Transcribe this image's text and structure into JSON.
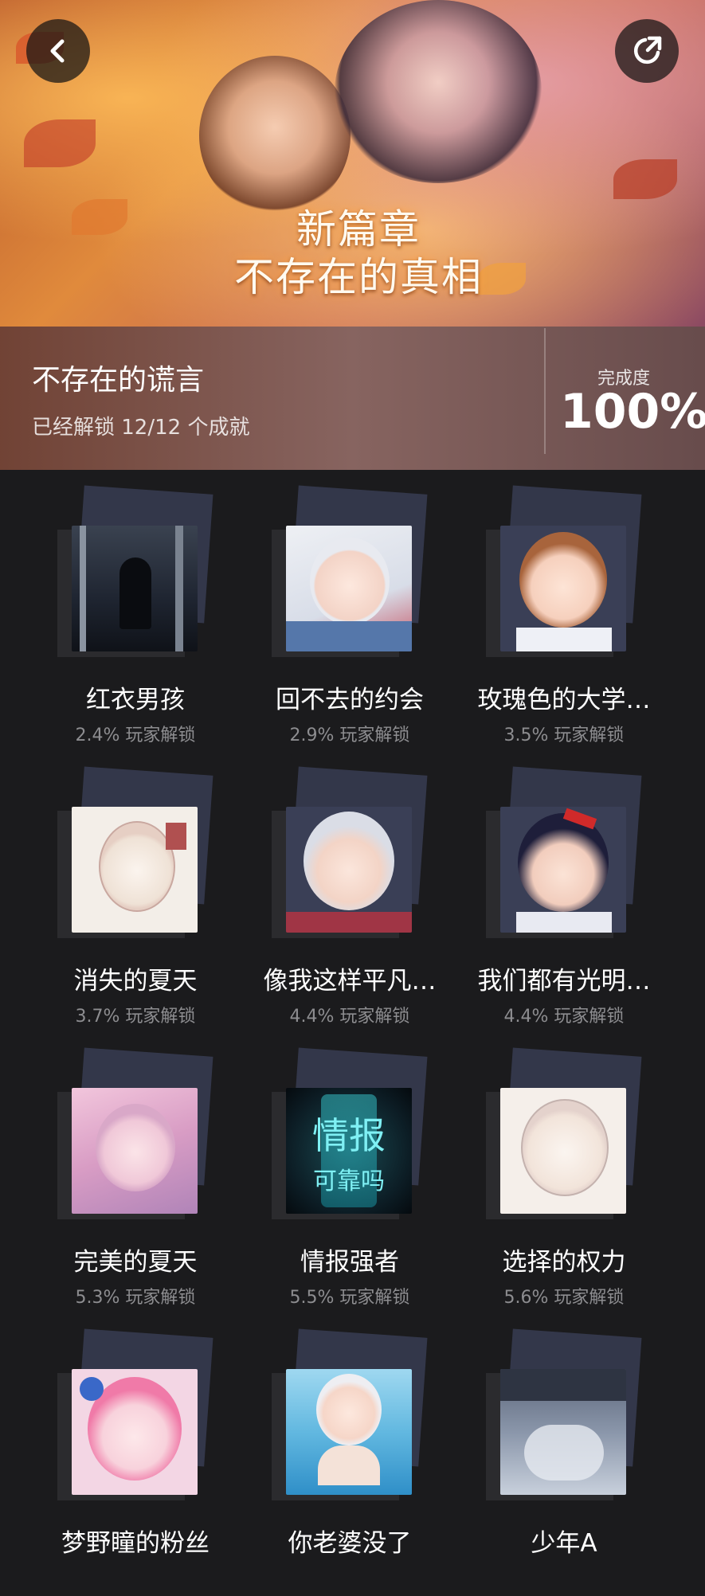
{
  "header": {
    "banner_title_line1": "新篇章",
    "banner_title_line2": "不存在的真相",
    "back_icon": "chevron-left-icon",
    "share_icon": "share-icon"
  },
  "chapter": {
    "title": "不存在的谎言",
    "unlocked": "已经解锁 12/12 个成就",
    "completion_label": "完成度",
    "completion_value": "100%"
  },
  "achievements": [
    {
      "name": "红衣男孩",
      "rate": "2.4% 玩家解锁"
    },
    {
      "name": "回不去的约会",
      "rate": "2.9% 玩家解锁"
    },
    {
      "name": "玫瑰色的大学…",
      "rate": "3.5% 玩家解锁"
    },
    {
      "name": "消失的夏天",
      "rate": "3.7% 玩家解锁"
    },
    {
      "name": "像我这样平凡…",
      "rate": "4.4% 玩家解锁"
    },
    {
      "name": "我们都有光明…",
      "rate": "4.4% 玩家解锁"
    },
    {
      "name": "完美的夏天",
      "rate": "5.3% 玩家解锁"
    },
    {
      "name": "情报强者",
      "rate": "5.5% 玩家解锁",
      "art_text1": "情报",
      "art_text2": "可靠吗"
    },
    {
      "name": "选择的权力",
      "rate": "5.6% 玩家解锁"
    },
    {
      "name": "梦野瞳的粉丝",
      "rate": ""
    },
    {
      "name": "你老婆没了",
      "rate": ""
    },
    {
      "name": "少年A",
      "rate": ""
    }
  ]
}
